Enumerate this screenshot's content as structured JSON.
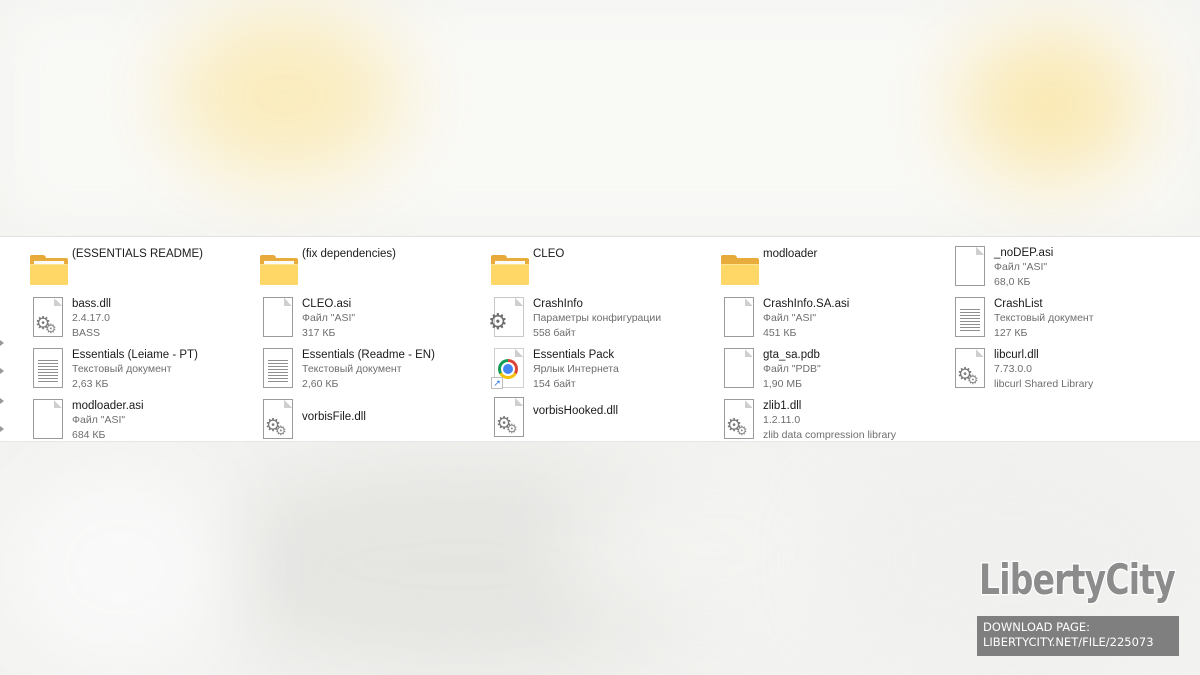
{
  "explorer": {
    "items": [
      {
        "name": "(ESSENTIALS README)",
        "icon": "folder-icon"
      },
      {
        "name": "(fix dependencies)",
        "icon": "folder-icon"
      },
      {
        "name": "CLEO",
        "icon": "folder-icon"
      },
      {
        "name": "modloader",
        "icon": "folder-icon"
      },
      {
        "name": "_noDEP.asi",
        "line1": "Файл \"ASI\"",
        "line2": "68,0 КБ",
        "icon": "file-icon"
      },
      {
        "name": "bass.dll",
        "line1": "2.4.17.0",
        "line2": "BASS",
        "icon": "dll-icon"
      },
      {
        "name": "CLEO.asi",
        "line1": "Файл \"ASI\"",
        "line2": "317 КБ",
        "icon": "file-icon"
      },
      {
        "name": "CrashInfo",
        "line1": "Параметры конфигурации",
        "line2": "558 байт",
        "icon": "settings-file-icon"
      },
      {
        "name": "CrashInfo.SA.asi",
        "line1": "Файл \"ASI\"",
        "line2": "451 КБ",
        "icon": "file-icon"
      },
      {
        "name": "CrashList",
        "line1": "Текстовый документ",
        "line2": "127 КБ",
        "icon": "text-document-icon"
      },
      {
        "name": "Essentials (Leiame - PT)",
        "line1": "Текстовый документ",
        "line2": "2,63 КБ",
        "icon": "text-document-icon"
      },
      {
        "name": "Essentials (Readme - EN)",
        "line1": "Текстовый документ",
        "line2": "2,60 КБ",
        "icon": "text-document-icon"
      },
      {
        "name": "Essentials Pack",
        "line1": "Ярлык Интернета",
        "line2": "154 байт",
        "icon": "chrome-shortcut-icon"
      },
      {
        "name": "gta_sa.pdb",
        "line1": "Файл \"PDB\"",
        "line2": "1,90 МБ",
        "icon": "file-icon"
      },
      {
        "name": "libcurl.dll",
        "line1": "7.73.0.0",
        "line2": "libcurl Shared Library",
        "icon": "dll-icon"
      },
      {
        "name": "modloader.asi",
        "line1": "Файл \"ASI\"",
        "line2": "684 КБ",
        "icon": "file-icon"
      },
      {
        "name": "vorbisFile.dll",
        "icon": "dll-icon"
      },
      {
        "name": "vorbisHooked.dll",
        "icon": "dll-icon"
      },
      {
        "name": "zlib1.dll",
        "line1": "1.2.11.0",
        "line2": "zlib data compression library",
        "icon": "dll-icon"
      }
    ]
  },
  "watermark": {
    "logo": "LibertyCity",
    "line1": "DOWNLOAD PAGE:",
    "line2": "LIBERTYCITY.NET/FILE/225073"
  },
  "colors": {
    "folder": "#ffd766",
    "folder_back": "#e8ac3c",
    "watermark_bg": "#7f7f7f"
  }
}
